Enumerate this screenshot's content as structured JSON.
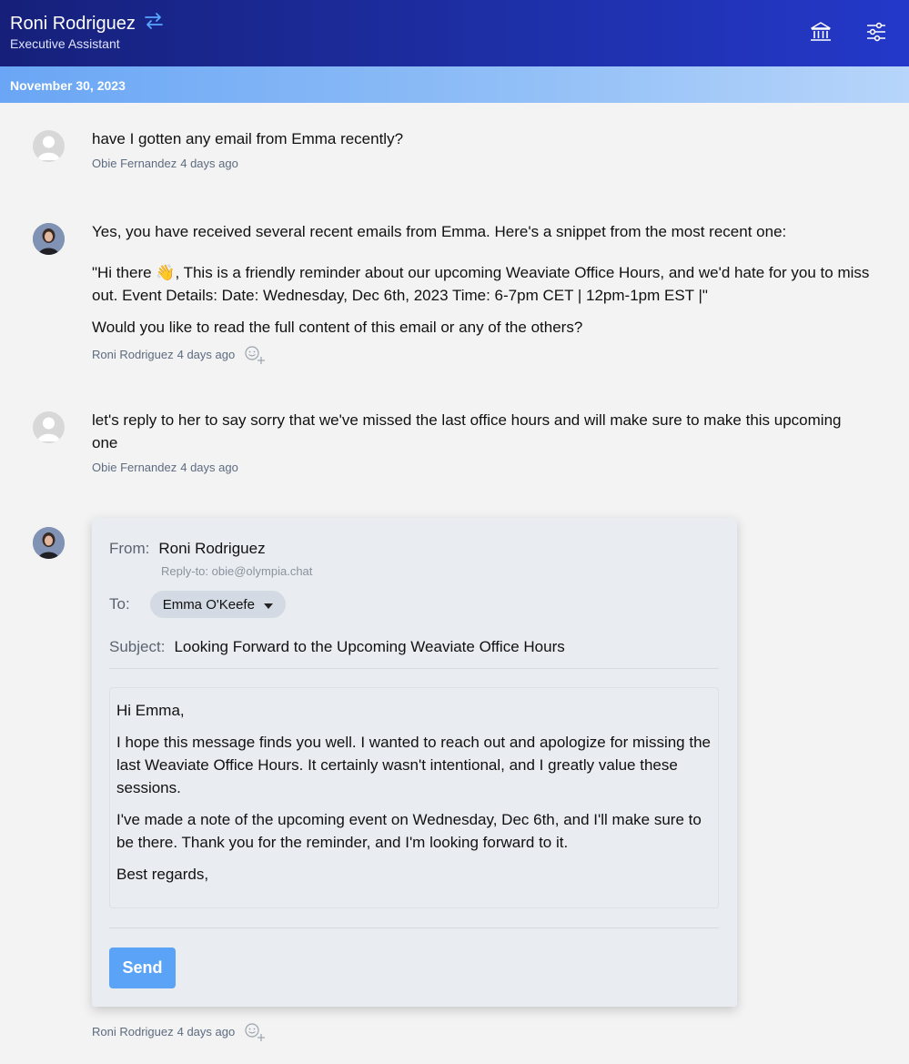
{
  "header": {
    "name": "Roni Rodriguez",
    "role": "Executive Assistant",
    "swap_icon": "swap-arrows-icon",
    "bank_icon": "bank-icon",
    "settings_icon": "sliders-icon"
  },
  "date": "November 30, 2023",
  "messages": [
    {
      "text": "have I gotten any email from Emma recently?",
      "author": "Obie Fernandez",
      "time": "4 days ago"
    },
    {
      "paragraphs": [
        "Yes, you have received several recent emails from Emma. Here's a snippet from the most recent one:",
        "\"Hi there 👋, This is a friendly reminder about our upcoming Weaviate Office Hours, and we'd hate for you to miss out. Event Details: Date: Wednesday, Dec 6th, 2023 Time: 6-7pm CET | 12pm-1pm EST |\"",
        "Would you like to read the full content of this email or any of the others?"
      ],
      "author": "Roni Rodriguez",
      "time": "4 days ago"
    },
    {
      "text": "let's reply to her to say sorry that we've missed the last office hours and will make sure to make this upcoming one",
      "author": "Obie Fernandez",
      "time": "4 days ago"
    }
  ],
  "email": {
    "from_label": "From:",
    "from_value": "Roni Rodriguez",
    "reply_to": "Reply-to: obie@olympia.chat",
    "to_label": "To:",
    "to_value": "Emma O'Keefe",
    "subject_label": "Subject:",
    "subject_value": "Looking Forward to the Upcoming Weaviate Office Hours",
    "body": [
      "Hi Emma,",
      "I hope this message finds you well. I wanted to reach out and apologize for missing the last Weaviate Office Hours. It certainly wasn't intentional, and I greatly value these sessions.",
      "I've made a note of the upcoming event on Wednesday, Dec 6th, and I'll make sure to be there. Thank you for the reminder, and I'm looking forward to it.",
      "Best regards,"
    ],
    "send_label": "Send",
    "author": "Roni Rodriguez",
    "time": "4 days ago"
  },
  "colors": {
    "header": "#1e2fa6",
    "date_bar": "#6aa6f5",
    "send": "#5aa3f6"
  }
}
